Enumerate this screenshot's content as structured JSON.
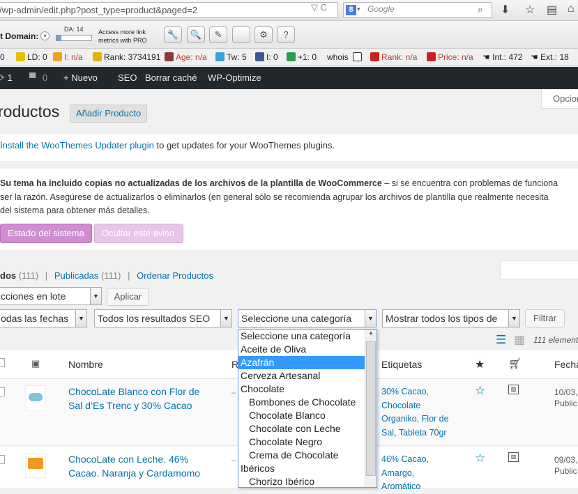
{
  "browser": {
    "url": "/wp-admin/edit.php?post_type=product&paged=2",
    "search_placeholder": "Google",
    "search_engine_letter": "8"
  },
  "seo_toolbar": {
    "domain_label": "t Domain:",
    "da_label": "DA: 14",
    "da_fraction": 0.14,
    "pro_text_line1": "Access more link",
    "pro_text_line2": "metrics with PRO",
    "stats": [
      {
        "text": "0"
      },
      {
        "text": "LD: 0"
      },
      {
        "text": "I: n/a"
      },
      {
        "text": "Rank: 3734191"
      },
      {
        "text": "Age: n/a"
      },
      {
        "text": "Tw: 5"
      },
      {
        "text": "I: 0"
      },
      {
        "text": "+1: 0"
      },
      {
        "text": "whois"
      },
      {
        "text": "Rank: n/a"
      },
      {
        "text": "Price: n/a"
      },
      {
        "text": "Int.: 472"
      },
      {
        "text": "Ext.: 18"
      }
    ]
  },
  "admin_bar": {
    "updates": "1",
    "comments": "0",
    "new": "Nuevo",
    "seo": "SEO",
    "clear_cache": "Borrar caché",
    "optimize": "WP-Optimize"
  },
  "screen_options": "Opcion",
  "page": {
    "title": "roductos",
    "add_button": "Añadir Producto"
  },
  "notice1": {
    "link": "Install the WooThemes Updater plugin",
    "text": " to get updates for your WooThemes plugins."
  },
  "notice2": {
    "bold": "Su tema ha incluido copias no actualizadas de los archivos de la plantilla de WooCommerce",
    "line1_rest": " – si se encuentra con problemas de funciona",
    "line2": "ser la razón. Asegúrese de actualizarlos o eliminarlos (en general sólo se recomienda agrupar los archivos de plantilla que realmente necesita",
    "line3": "del sistema para obtener más detalles.",
    "btn_status": "Estado del sistema",
    "btn_hide": "Ocultar este aviso"
  },
  "subsub": {
    "all": "dos",
    "all_count": "(111)",
    "published": "Publicadas",
    "published_count": "(111)",
    "order": "Ordenar Productos",
    "sep": "|"
  },
  "filters": {
    "bulk": "cciones en lote",
    "apply": "Aplicar",
    "dates": "odas las fechas",
    "seo": "Todos los resultados SEO",
    "category": "Seleccione una categoría",
    "types": "Mostrar todos los tipos de",
    "filter": "Filtrar",
    "count": "111 element"
  },
  "category_options": [
    {
      "label": "Seleccione una categoría",
      "child": false,
      "selected": false
    },
    {
      "label": "Aceite de Oliva",
      "child": false,
      "selected": false
    },
    {
      "label": "Azafrán",
      "child": false,
      "selected": true
    },
    {
      "label": "Cerveza Artesanal",
      "child": false,
      "selected": false
    },
    {
      "label": "Chocolate",
      "child": false,
      "selected": false
    },
    {
      "label": "Bombones de Chocolate",
      "child": true,
      "selected": false
    },
    {
      "label": "Chocolate Blanco",
      "child": true,
      "selected": false
    },
    {
      "label": "Chocolate con Leche",
      "child": true,
      "selected": false
    },
    {
      "label": "Chocolate Negro",
      "child": true,
      "selected": false
    },
    {
      "label": "Crema de Chocolate",
      "child": true,
      "selected": false
    },
    {
      "label": "Ibéricos",
      "child": false,
      "selected": false
    },
    {
      "label": "Chorizo Ibérico",
      "child": true,
      "selected": false
    }
  ],
  "table": {
    "col_name": "Nombre",
    "col_r": "R",
    "col_tags": "Etiquetas",
    "col_date": "Fecha",
    "rows": [
      {
        "name_line1": "ChocoLate Blanco con Flor de",
        "name_line2": "Sal d’Es Trenc y 30% Cacao",
        "dash": "–",
        "tags": [
          "30% Cacao,",
          "Chocolate",
          "Organiko, Flor de",
          "Sal, Tableta 70gr"
        ],
        "date_line1": "10/03,",
        "date_line2": "Public"
      },
      {
        "name_line1": "ChocoLate con Leche. 46%",
        "name_line2": "Cacao. Naranja y Cardamomo",
        "dash": "–",
        "tags": [
          "46% Cacao,",
          "Amargo,",
          "Aromático"
        ],
        "date_line1": "09/03,",
        "date_line2": "Public"
      }
    ]
  },
  "colors": {
    "admin_bar": "#23282d",
    "link": "#0073aa",
    "purple": "#d08ed0",
    "highlight": "#3399ff"
  }
}
